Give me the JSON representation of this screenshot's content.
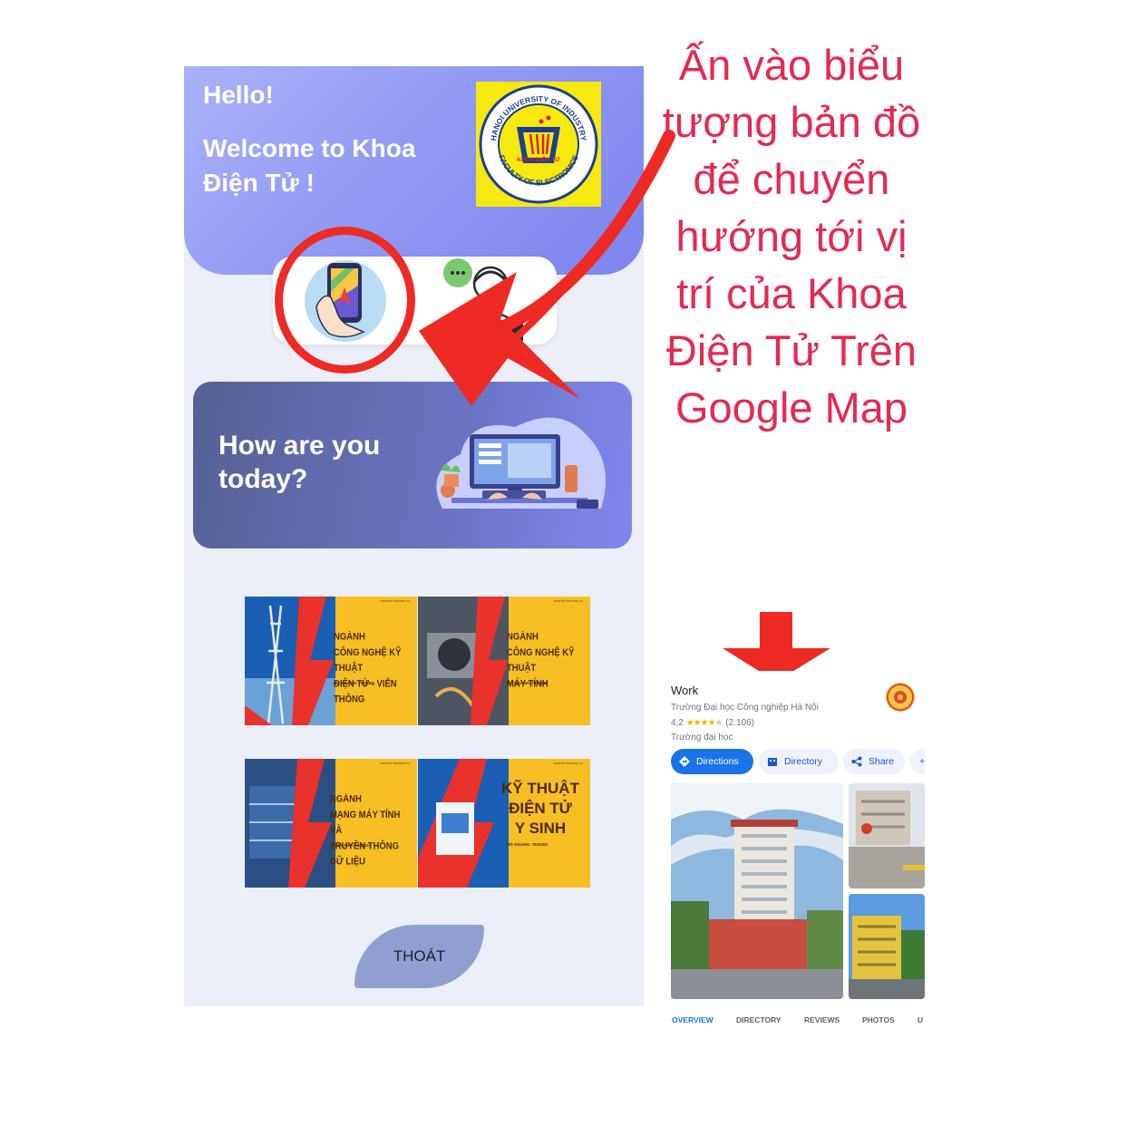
{
  "app": {
    "hello": "Hello!",
    "welcome": "Welcome to Khoa Điện Tử !",
    "logo_text_top": "HANOI UNIVERSITY OF INDUSTRY",
    "logo_text_bottom": "FACULTY OF ELECTRONICS",
    "logo_text_center": "KHOA ĐIỆN TỬ",
    "mood_question": "How are you today?",
    "banners": [
      {
        "line1": "NGÀNH",
        "line2": "CÔNG NGHỆ KỸ THUẬT",
        "line3": "ĐIỆN TỬ - VIỄN THÔNG",
        "code": "MÃ NGÀNH: 7510302"
      },
      {
        "line1": "NGÀNH",
        "line2": "CÔNG NGHỆ KỸ THUẬT",
        "line3": "MÁY TÍNH",
        "code": "MÃ NGÀNH: 7480108"
      },
      {
        "line1": "NGÀNH",
        "line2": "MẠNG MÁY TÍNH VÀ",
        "line3": "TRUYỀN THÔNG DỮ LIỆU",
        "code": "MÃ NGÀNH: 7480102"
      },
      {
        "line1": "KỸ THUẬT",
        "line2": "ĐIỆN TỬ",
        "line3": "Y SINH",
        "code": "MÃ NGÀNH: 7510302"
      }
    ],
    "banner_site": "www.fee.haui.edu.vn",
    "exit_label": "THOÁT"
  },
  "annotation": {
    "instruction": "Ấn vào biểu tượng bản đồ để chuyển hướng tới vị trí của Khoa Điện Tử Trên Google Map"
  },
  "maps": {
    "title": "Work",
    "place": "Trường Đại học Công nghiệp Hà Nội",
    "rating": "4,2",
    "stars": "★★★★",
    "star_empty": "★",
    "review_count": "(2.106)",
    "category": "Trường đại học",
    "chips": {
      "directions": "Directions",
      "directory": "Directory",
      "share": "Share",
      "more": "+"
    },
    "tabs": {
      "overview": "OVERVIEW",
      "directory": "DIRECTORY",
      "reviews": "REVIEWS",
      "photos": "PHOTOS",
      "more": "U"
    }
  },
  "colors": {
    "annotation_red": "#ee2a24",
    "instruction_text": "#e42a52",
    "hero_blue": "#8f98f3",
    "banner_yellow": "#f8bf24",
    "maps_blue": "#1a73e8"
  },
  "icons": [
    "map-navigation-icon",
    "customer-support-icon",
    "directions-icon",
    "directory-icon",
    "share-icon"
  ]
}
